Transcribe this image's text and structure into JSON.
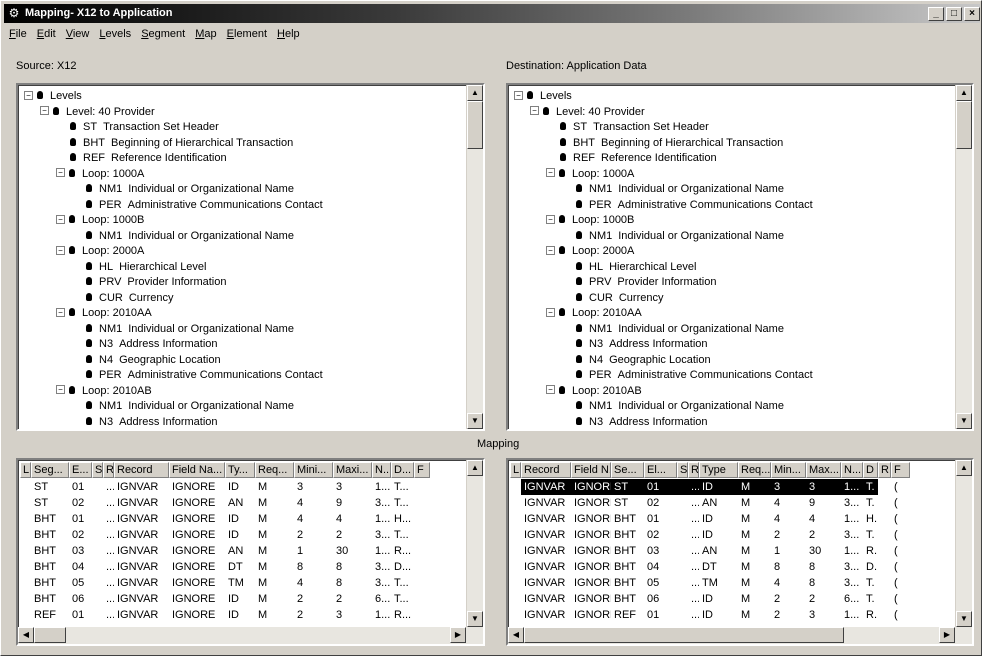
{
  "window": {
    "title": "Mapping- X12 to Application",
    "app_icon": "wrench-icon",
    "minimize": "_",
    "maximize": "□",
    "close": "×"
  },
  "menu": [
    "File",
    "Edit",
    "View",
    "Levels",
    "Segment",
    "Map",
    "Element",
    "Help"
  ],
  "source_label": "Source: X12",
  "destination_label": "Destination: Application Data",
  "mapping_label": "Mapping",
  "tree": [
    {
      "depth": 0,
      "toggle": "−",
      "text": "Levels"
    },
    {
      "depth": 1,
      "toggle": "−",
      "text": "Level:  40  Provider"
    },
    {
      "depth": 2,
      "toggle": "",
      "seg": "ST",
      "text": "Transaction Set Header"
    },
    {
      "depth": 2,
      "toggle": "",
      "seg": "BHT",
      "text": "Beginning of Hierarchical Transaction"
    },
    {
      "depth": 2,
      "toggle": "",
      "seg": "REF",
      "text": "Reference Identification"
    },
    {
      "depth": 2,
      "toggle": "−",
      "text": "Loop:  1000A"
    },
    {
      "depth": 3,
      "toggle": "",
      "seg": "NM1",
      "text": "Individual or Organizational Name"
    },
    {
      "depth": 3,
      "toggle": "",
      "seg": "PER",
      "text": "Administrative Communications Contact"
    },
    {
      "depth": 2,
      "toggle": "−",
      "text": "Loop:  1000B"
    },
    {
      "depth": 3,
      "toggle": "",
      "seg": "NM1",
      "text": "Individual or Organizational Name"
    },
    {
      "depth": 2,
      "toggle": "−",
      "text": "Loop:  2000A"
    },
    {
      "depth": 3,
      "toggle": "",
      "seg": "HL",
      "text": "Hierarchical Level"
    },
    {
      "depth": 3,
      "toggle": "",
      "seg": "PRV",
      "text": "Provider Information"
    },
    {
      "depth": 3,
      "toggle": "",
      "seg": "CUR",
      "text": "Currency"
    },
    {
      "depth": 2,
      "toggle": "−",
      "text": "Loop:  2010AA"
    },
    {
      "depth": 3,
      "toggle": "",
      "seg": "NM1",
      "text": "Individual or Organizational Name"
    },
    {
      "depth": 3,
      "toggle": "",
      "seg": "N3",
      "text": "Address Information"
    },
    {
      "depth": 3,
      "toggle": "",
      "seg": "N4",
      "text": "Geographic Location"
    },
    {
      "depth": 3,
      "toggle": "",
      "seg": "PER",
      "text": "Administrative Communications Contact"
    },
    {
      "depth": 2,
      "toggle": "−",
      "text": "Loop:  2010AB"
    },
    {
      "depth": 3,
      "toggle": "",
      "seg": "NM1",
      "text": "Individual or Organizational Name"
    },
    {
      "depth": 3,
      "toggle": "",
      "seg": "N3",
      "text": "Address Information"
    }
  ],
  "left_grid": {
    "headers": [
      "L",
      "Seg...",
      "E...",
      "S",
      "R",
      "Record",
      "Field Na...",
      "Ty...",
      "Req...",
      "Mini...",
      "Maxi...",
      "N...",
      "D...",
      "F"
    ],
    "rows": [
      [
        "",
        "ST",
        "01",
        "",
        "...",
        "IGNVAR",
        "IGNORE",
        "ID",
        "M",
        "3",
        "3",
        "1...",
        "T...",
        ""
      ],
      [
        "",
        "ST",
        "02",
        "",
        "...",
        "IGNVAR",
        "IGNORE",
        "AN",
        "M",
        "4",
        "9",
        "3...",
        "T...",
        ""
      ],
      [
        "",
        "BHT",
        "01",
        "",
        "...",
        "IGNVAR",
        "IGNORE",
        "ID",
        "M",
        "4",
        "4",
        "1...",
        "H...",
        ""
      ],
      [
        "",
        "BHT",
        "02",
        "",
        "...",
        "IGNVAR",
        "IGNORE",
        "ID",
        "M",
        "2",
        "2",
        "3...",
        "T...",
        ""
      ],
      [
        "",
        "BHT",
        "03",
        "",
        "...",
        "IGNVAR",
        "IGNORE",
        "AN",
        "M",
        "1",
        "30",
        "1...",
        "R...",
        ""
      ],
      [
        "",
        "BHT",
        "04",
        "",
        "...",
        "IGNVAR",
        "IGNORE",
        "DT",
        "M",
        "8",
        "8",
        "3...",
        "D...",
        ""
      ],
      [
        "",
        "BHT",
        "05",
        "",
        "...",
        "IGNVAR",
        "IGNORE",
        "TM",
        "M",
        "4",
        "8",
        "3...",
        "T...",
        ""
      ],
      [
        "",
        "BHT",
        "06",
        "",
        "...",
        "IGNVAR",
        "IGNORE",
        "ID",
        "M",
        "2",
        "2",
        "6...",
        "T...",
        ""
      ],
      [
        "",
        "REF",
        "01",
        "",
        "...",
        "IGNVAR",
        "IGNORE",
        "ID",
        "M",
        "2",
        "3",
        "1...",
        "R...",
        ""
      ]
    ]
  },
  "right_grid": {
    "headers": [
      "L",
      "Record",
      "Field N...",
      "Se...",
      "El...",
      "S",
      "R",
      "Type",
      "Req...",
      "Min...",
      "Max...",
      "N...",
      "D",
      "R",
      "F"
    ],
    "rows": [
      [
        "",
        "IGNVAR",
        "IGNORE",
        "ST",
        "01",
        "",
        "...",
        "ID",
        "M",
        "3",
        "3",
        "1...",
        "T.",
        "",
        "("
      ],
      [
        "",
        "IGNVAR",
        "IGNORE",
        "ST",
        "02",
        "",
        "...",
        "AN",
        "M",
        "4",
        "9",
        "3...",
        "T.",
        "",
        "("
      ],
      [
        "",
        "IGNVAR",
        "IGNORE",
        "BHT",
        "01",
        "",
        "...",
        "ID",
        "M",
        "4",
        "4",
        "1...",
        "H.",
        "",
        "("
      ],
      [
        "",
        "IGNVAR",
        "IGNORE",
        "BHT",
        "02",
        "",
        "...",
        "ID",
        "M",
        "2",
        "2",
        "3...",
        "T.",
        "",
        "("
      ],
      [
        "",
        "IGNVAR",
        "IGNORE",
        "BHT",
        "03",
        "",
        "...",
        "AN",
        "M",
        "1",
        "30",
        "1...",
        "R.",
        "",
        "("
      ],
      [
        "",
        "IGNVAR",
        "IGNORE",
        "BHT",
        "04",
        "",
        "...",
        "DT",
        "M",
        "8",
        "8",
        "3...",
        "D.",
        "",
        "("
      ],
      [
        "",
        "IGNVAR",
        "IGNORE",
        "BHT",
        "05",
        "",
        "...",
        "TM",
        "M",
        "4",
        "8",
        "3...",
        "T.",
        "",
        "("
      ],
      [
        "",
        "IGNVAR",
        "IGNORE",
        "BHT",
        "06",
        "",
        "...",
        "ID",
        "M",
        "2",
        "2",
        "6...",
        "T.",
        "",
        "("
      ],
      [
        "",
        "IGNVAR",
        "IGNORE",
        "REF",
        "01",
        "",
        "...",
        "ID",
        "M",
        "2",
        "3",
        "1...",
        "R.",
        "",
        "("
      ]
    ],
    "selected_row": 0
  }
}
